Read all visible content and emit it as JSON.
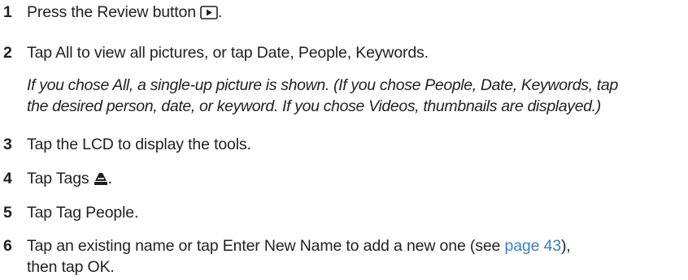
{
  "steps": [
    {
      "number": "1",
      "text": "Press the Review button",
      "icon": "review-button-icon",
      "suffix": "."
    },
    {
      "number": "2",
      "text": "Tap All to view all pictures, or tap Date, People, Keywords."
    },
    {
      "number": "3",
      "text": "Tap the LCD to display the tools."
    },
    {
      "number": "4",
      "text": "Tap Tags",
      "icon": "tag-icon",
      "suffix": "."
    },
    {
      "number": "5",
      "text": "Tap Tag People."
    },
    {
      "number": "6",
      "text_before": "Tap an existing name or tap Enter New Name to add a new one (see ",
      "link_text": "page 43",
      "text_after": "),",
      "text_line2": "then tap OK."
    }
  ],
  "note": {
    "line1": "If you chose All, a single-up picture is shown. (If you chose People, Date, Keywords, tap",
    "line2": "the desired person, date, or keyword. If you chose Videos, thumbnails are displayed.)"
  },
  "colors": {
    "text": "#231f20",
    "link": "#3b7fc4"
  }
}
